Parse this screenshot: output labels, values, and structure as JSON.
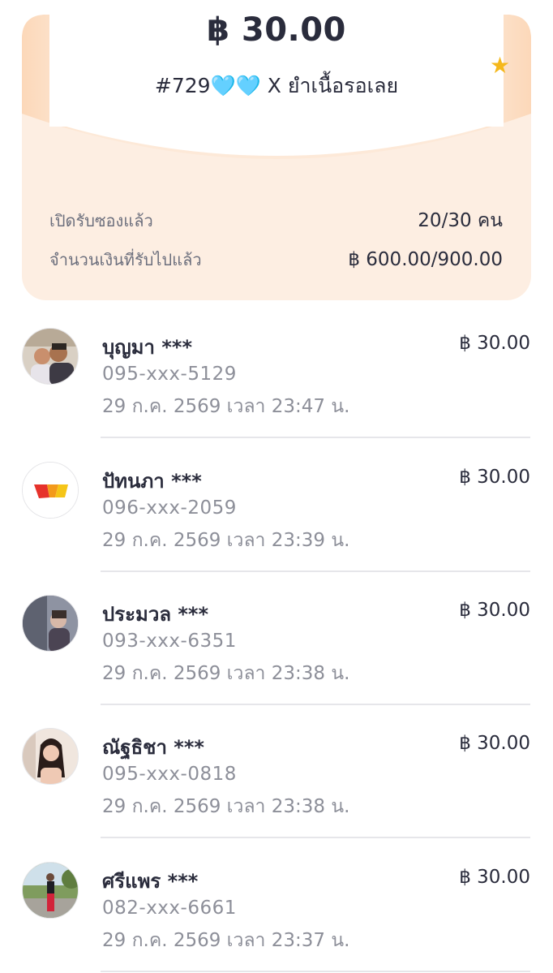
{
  "envelope": {
    "amount": "฿ 30.00",
    "title_prefix": "#729",
    "hearts": "🩵🩵",
    "title_suffix": " X ยำเนื้อรอเลย"
  },
  "stats": {
    "opened_label": "เปิดรับซองแล้ว",
    "opened_value": "20/30 คน",
    "received_label": "จำนวนเงินที่รับไปแล้ว",
    "received_value": "฿ 600.00/900.00"
  },
  "recipients": [
    {
      "name": "บุญมา ***",
      "phone": "095-xxx-5129",
      "time": "29 ก.ค. 2569 เวลา 23:47 น.",
      "amount": "฿ 30.00",
      "avatar": "couple-photo"
    },
    {
      "name": "ปัทนภา ***",
      "phone": "096-xxx-2059",
      "time": "29 ก.ค. 2569 เวลา 23:39 น.",
      "amount": "฿ 30.00",
      "avatar": "wallet-logo"
    },
    {
      "name": "ประมวล ***",
      "phone": "093-xxx-6351",
      "time": "29 ก.ค. 2569 เวลา 23:38 น.",
      "amount": "฿ 30.00",
      "avatar": "person-photo"
    },
    {
      "name": "ณัฐธิชา ***",
      "phone": "095-xxx-0818",
      "time": "29 ก.ค. 2569 เวลา 23:38 น.",
      "amount": "฿ 30.00",
      "avatar": "woman-photo"
    },
    {
      "name": "ศรีแพร ***",
      "phone": "082-xxx-6661",
      "time": "29 ก.ค. 2569 เวลา 23:37 น.",
      "amount": "฿ 30.00",
      "avatar": "outdoor-photo"
    }
  ],
  "colors": {
    "card_bg": "#fdeee2",
    "accent_star": "#f5b81c",
    "heart": "#5ec8ef"
  }
}
